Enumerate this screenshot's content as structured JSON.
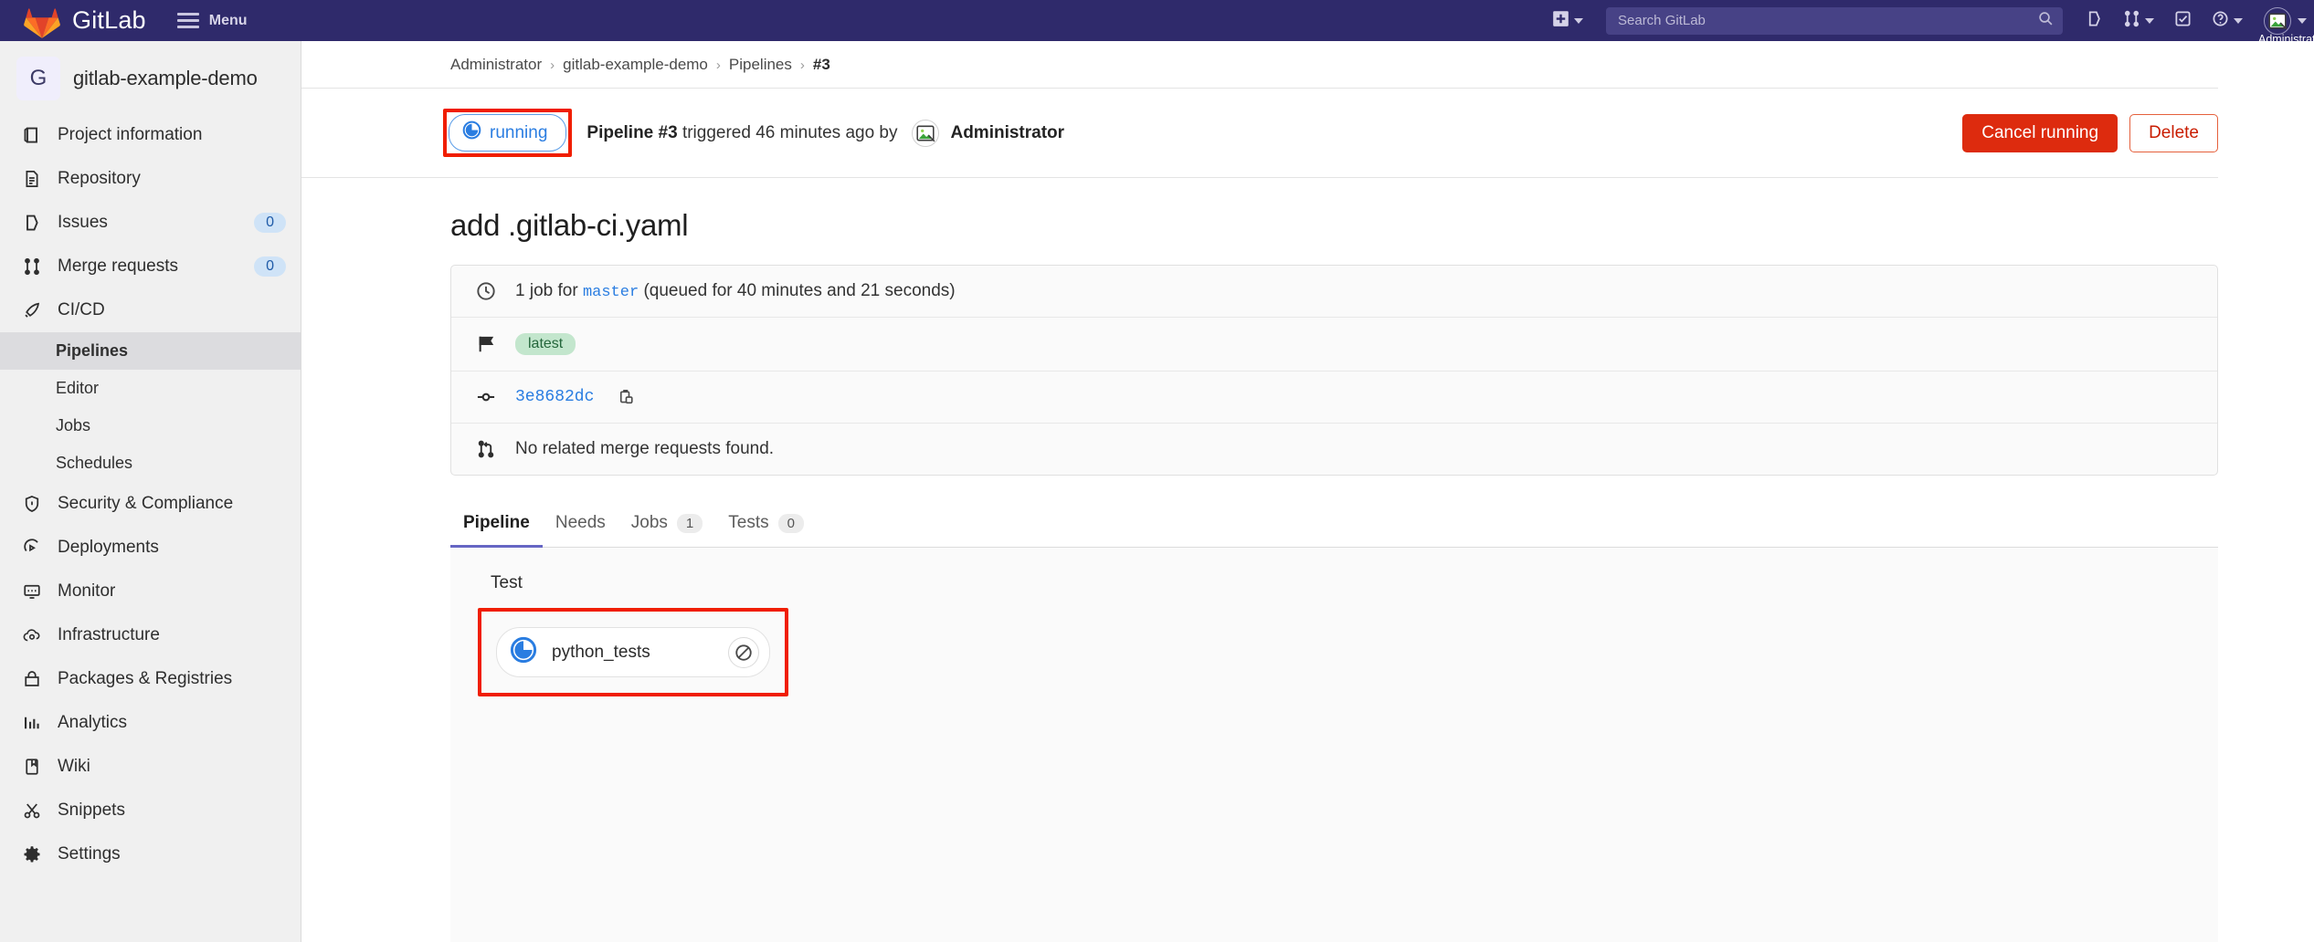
{
  "topbar": {
    "brand": "GitLab",
    "menu_label": "Menu",
    "menu_icon": "hamburger-icon",
    "logo_icon": "gitlab-logo-icon",
    "new_icon": "plus-square-icon",
    "search_placeholder": "Search GitLab",
    "search_icon": "search-icon",
    "issues_icon": "issues-icon",
    "merge_requests_icon": "merge-request-icon",
    "todos_icon": "todo-checkbox-icon",
    "help_icon": "help-circle-icon",
    "avatar_icon": "broken-image-avatar-icon",
    "user_name": "Administrator"
  },
  "sidebar": {
    "project_initial": "G",
    "project_name": "gitlab-example-demo",
    "items": [
      {
        "label": "Project information",
        "icon": "project-information-icon",
        "badge": null
      },
      {
        "label": "Repository",
        "icon": "repository-icon",
        "badge": null
      },
      {
        "label": "Issues",
        "icon": "issues-icon",
        "badge": "0"
      },
      {
        "label": "Merge requests",
        "icon": "merge-request-icon",
        "badge": "0"
      },
      {
        "label": "CI/CD",
        "icon": "rocket-icon",
        "badge": null
      },
      {
        "label": "Security & Compliance",
        "icon": "shield-icon",
        "badge": null
      },
      {
        "label": "Deployments",
        "icon": "deployments-icon",
        "badge": null
      },
      {
        "label": "Monitor",
        "icon": "monitor-icon",
        "badge": null
      },
      {
        "label": "Infrastructure",
        "icon": "cloud-gear-icon",
        "badge": null
      },
      {
        "label": "Packages & Registries",
        "icon": "package-icon",
        "badge": null
      },
      {
        "label": "Analytics",
        "icon": "chart-bar-icon",
        "badge": null
      },
      {
        "label": "Wiki",
        "icon": "book-icon",
        "badge": null
      },
      {
        "label": "Snippets",
        "icon": "scissors-icon",
        "badge": null
      },
      {
        "label": "Settings",
        "icon": "gear-icon",
        "badge": null
      }
    ],
    "subitems": [
      {
        "label": "Pipelines",
        "active": true
      },
      {
        "label": "Editor",
        "active": false
      },
      {
        "label": "Jobs",
        "active": false
      },
      {
        "label": "Schedules",
        "active": false
      }
    ]
  },
  "breadcrumb": {
    "items": [
      "Administrator",
      "gitlab-example-demo",
      "Pipelines"
    ],
    "separator": "›",
    "current": "#3"
  },
  "pipeline_header": {
    "status_label": "running",
    "status_icon": "running-pie-icon",
    "title_bold": "Pipeline #3",
    "title_rest": " triggered 46 minutes ago by",
    "user_name": "Administrator",
    "user_avatar_icon": "broken-image-avatar-icon",
    "cancel_label": "Cancel running",
    "delete_label": "Delete"
  },
  "commit": {
    "title": "add .gitlab-ci.yaml",
    "jobs_prefix": "1 job for",
    "branch": "master",
    "queued_text": "(queued for 40 minutes and 21 seconds)",
    "clock_icon": "clock-icon",
    "flag_icon": "flag-icon",
    "latest_badge": "latest",
    "commit_icon": "commit-node-icon",
    "sha": "3e8682dc",
    "copy_icon": "clipboard-copy-icon",
    "mr_icon": "merge-request-icon",
    "mr_text": "No related merge requests found."
  },
  "tabs": [
    {
      "label": "Pipeline",
      "badge": null,
      "active": true
    },
    {
      "label": "Needs",
      "badge": null,
      "active": false
    },
    {
      "label": "Jobs",
      "badge": "1",
      "active": false
    },
    {
      "label": "Tests",
      "badge": "0",
      "active": false
    }
  ],
  "graph": {
    "stage_name": "Test",
    "job_name": "python_tests",
    "job_status_icon": "running-pie-icon",
    "job_cancel_icon": "cancel-circle-slash-icon"
  },
  "colors": {
    "topbar_bg": "#2f2a6b",
    "sidebar_bg": "#f0f0f0",
    "accent_running": "#2a7de1",
    "danger": "#dd2b0e",
    "annotation": "#f01e00",
    "tab_active": "#6666c4",
    "badge_latest_bg": "#c3e6cd"
  }
}
